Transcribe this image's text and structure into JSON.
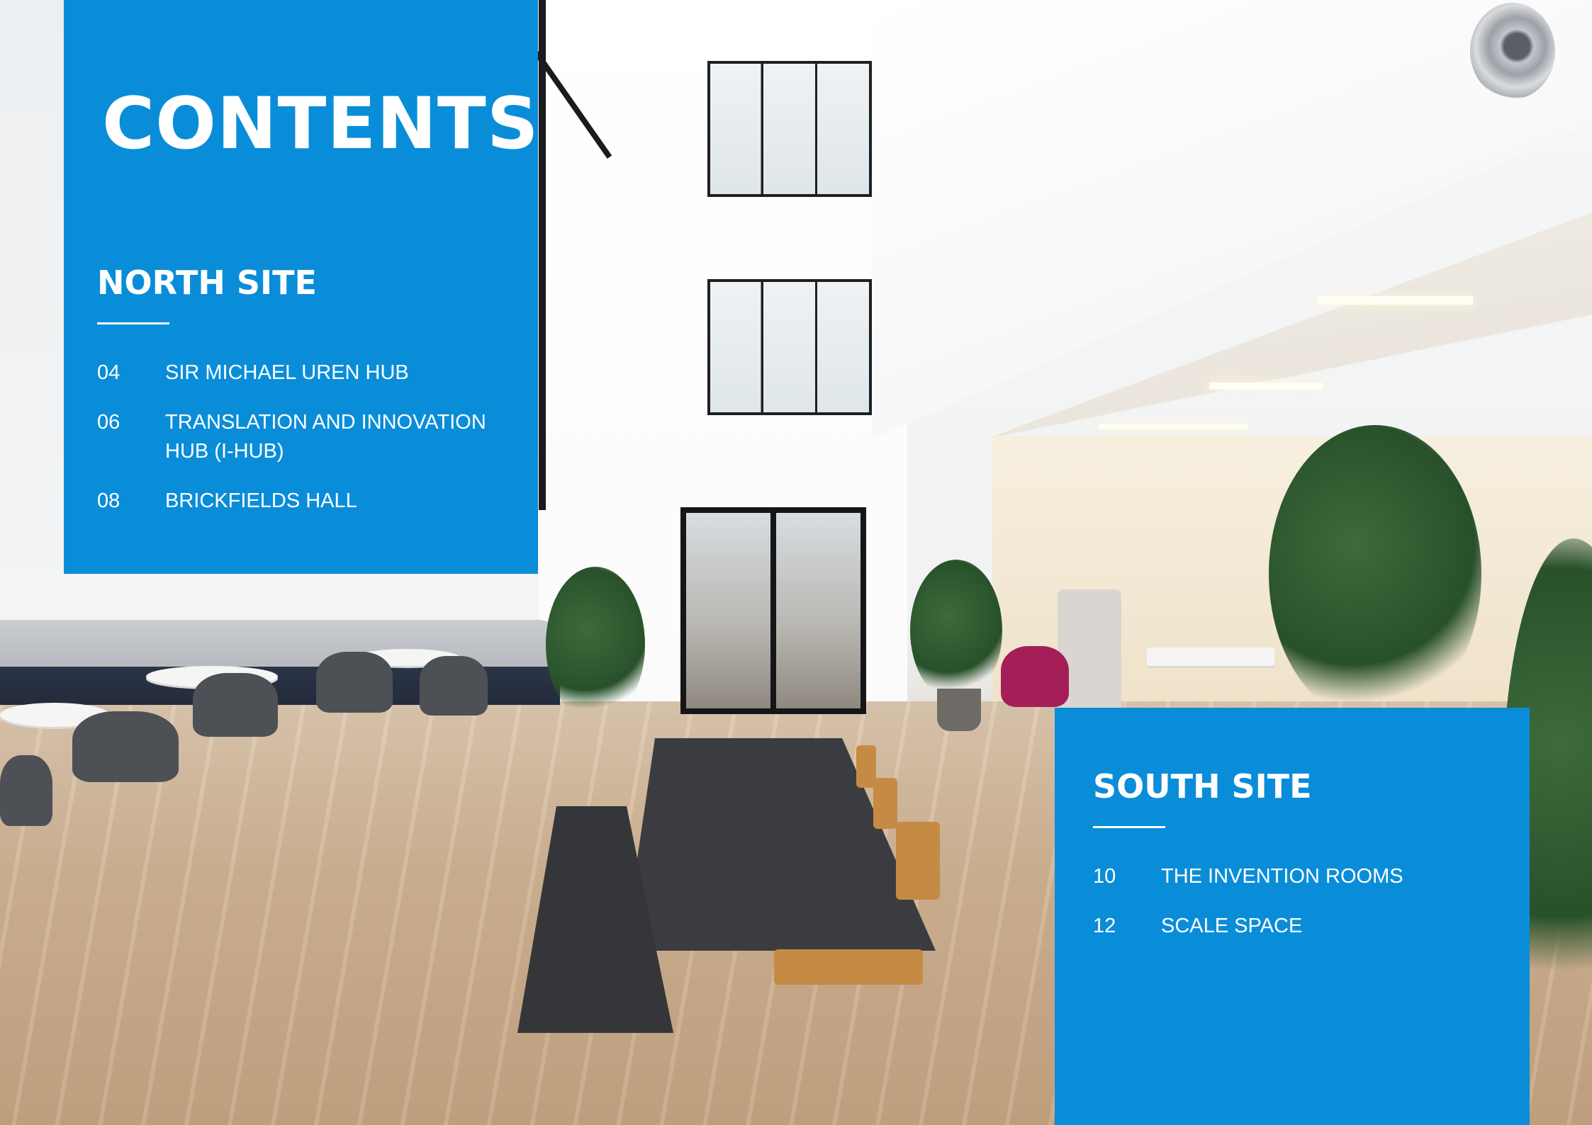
{
  "title": "CONTENTS",
  "north_site": {
    "heading": "NORTH SITE",
    "items": [
      {
        "page": "04",
        "label": "SIR MICHAEL UREN HUB"
      },
      {
        "page": "06",
        "label": "TRANSLATION AND INNOVATION",
        "label_line2": "HUB (I-HUB)"
      },
      {
        "page": "08",
        "label": "BRICKFIELDS HALL"
      }
    ]
  },
  "south_site": {
    "heading": "SOUTH SITE",
    "items": [
      {
        "page": "10",
        "label": "THE INVENTION ROOMS"
      },
      {
        "page": "12",
        "label": "SCALE SPACE"
      }
    ]
  },
  "colors": {
    "panel_blue": "#0a8dd9",
    "text": "#ffffff"
  }
}
